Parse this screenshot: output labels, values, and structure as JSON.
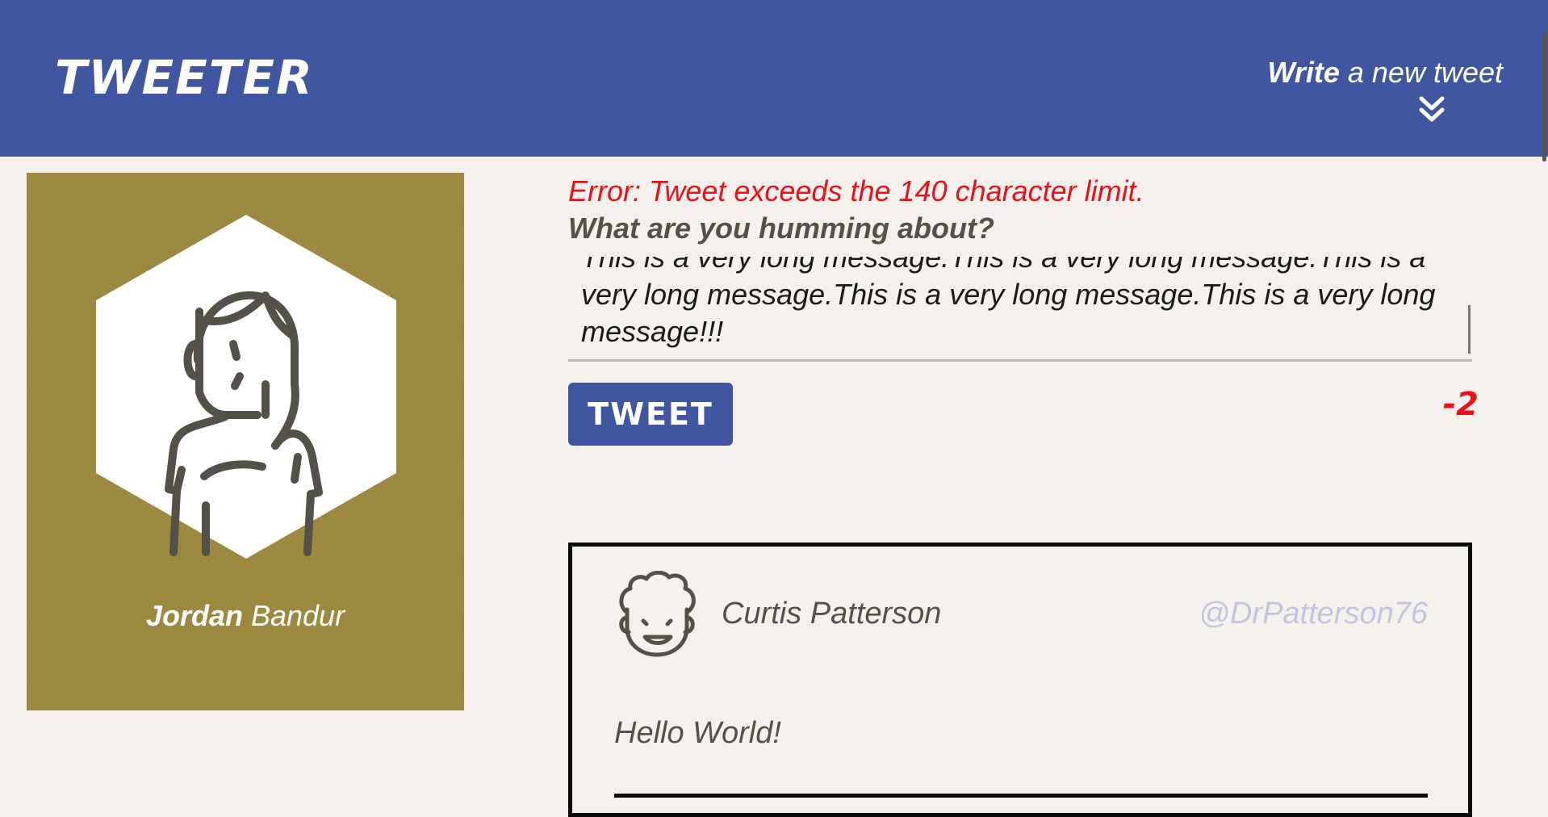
{
  "app": {
    "logo": "TWEETER"
  },
  "nav": {
    "compose_bold": "Write",
    "compose_rest": " a new tweet",
    "compose_icon": "double-chevron-down-icon"
  },
  "profile": {
    "first_name": "Jordan",
    "last_name": " Bandur",
    "avatar": "user-avatar-icon",
    "background_color": "#9c883f"
  },
  "composer": {
    "error": "Error: Tweet exceeds the 140 character limit.",
    "prompt": "What are you humming about?",
    "text": "This is a very long message.This is a very long message.This is a very long message.This is a very long message.This is a very long message!!!",
    "button_label": "TWEET",
    "counter": "-2"
  },
  "tweet": {
    "name": "Curtis Patterson",
    "handle": "@DrPatterson76",
    "body": "Hello World!",
    "avatar": "curly-hair-avatar-icon"
  },
  "colors": {
    "nav": "#4056a1",
    "error": "#e8111a",
    "page_bg": "#f4f1ec"
  }
}
